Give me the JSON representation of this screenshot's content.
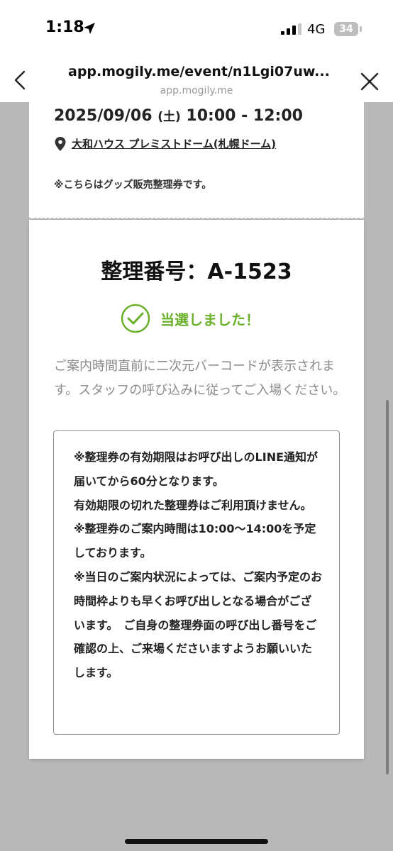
{
  "status_bar": {
    "time": "1:18",
    "network": "4G",
    "battery": "34"
  },
  "browser": {
    "url_title": "app.mogily.me/event/n1Lgi07uw...",
    "domain": "app.mogily.me"
  },
  "event": {
    "date": "2025/09/06",
    "day_of_week": "(土)",
    "time_range": "10:00 - 12:00",
    "venue": "大和ハウス プレミストドーム(札幌ドーム)",
    "note": "※こちらはグッズ販売整理券です。"
  },
  "ticket": {
    "number_label": "整理番号：A-1523",
    "status": "当選しました！",
    "status_color": "#6ab02b",
    "guide": "ご案内時間直前に二次元バーコードが表示されます。スタッフの呼び込みに従ってご入場ください。"
  },
  "notice": {
    "paragraph1": "※整理券の有効期限はお呼び出しのLINE通知が届いてから60分となります。",
    "paragraph2": "有効期限の切れた整理券はご利用頂けません。",
    "paragraph3": "※整理券のご案内時間は10:00〜14:00を予定しております。",
    "paragraph4": "※当日のご案内状況によっては、ご案内予定のお時間枠よりも早くお呼び出しとなる場合がございます。　ご自身の整理券面の呼び出し番号をご確認の上、ご来場くださいますようお願いいたします。"
  }
}
